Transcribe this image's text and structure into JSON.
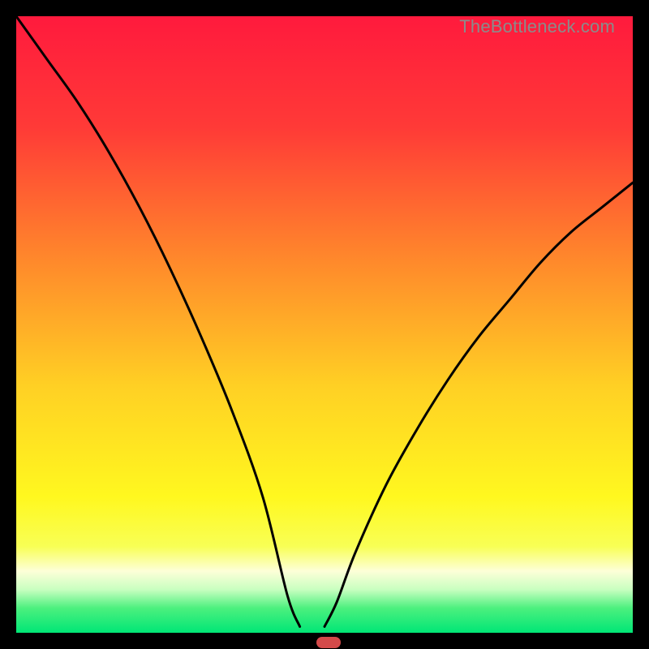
{
  "watermark": "TheBottleneck.com",
  "chart_data": {
    "type": "line",
    "title": "",
    "xlabel": "",
    "ylabel": "",
    "xlim": [
      0,
      100
    ],
    "ylim": [
      0,
      100
    ],
    "grid": false,
    "series": [
      {
        "name": "left-curve",
        "x": [
          0,
          5,
          10,
          15,
          20,
          25,
          30,
          35,
          40,
          44,
          46
        ],
        "y": [
          100,
          93,
          86,
          78,
          69,
          59,
          48,
          36,
          22,
          6,
          1
        ]
      },
      {
        "name": "right-curve",
        "x": [
          50,
          52,
          55,
          60,
          65,
          70,
          75,
          80,
          85,
          90,
          95,
          100
        ],
        "y": [
          1,
          5,
          13,
          24,
          33,
          41,
          48,
          54,
          60,
          65,
          69,
          73
        ]
      }
    ],
    "marker": {
      "x": 48,
      "y": 1,
      "color": "#d44a4a"
    },
    "background_gradient": {
      "stops": [
        {
          "offset": 0.0,
          "color": "#ff1a3d"
        },
        {
          "offset": 0.18,
          "color": "#ff3a37"
        },
        {
          "offset": 0.4,
          "color": "#ff8a2b"
        },
        {
          "offset": 0.6,
          "color": "#ffd024"
        },
        {
          "offset": 0.78,
          "color": "#fff81f"
        },
        {
          "offset": 0.86,
          "color": "#f8ff55"
        },
        {
          "offset": 0.9,
          "color": "#fdffd8"
        },
        {
          "offset": 0.93,
          "color": "#c8ffc0"
        },
        {
          "offset": 0.96,
          "color": "#4cf07e"
        },
        {
          "offset": 1.0,
          "color": "#00e676"
        }
      ]
    }
  }
}
